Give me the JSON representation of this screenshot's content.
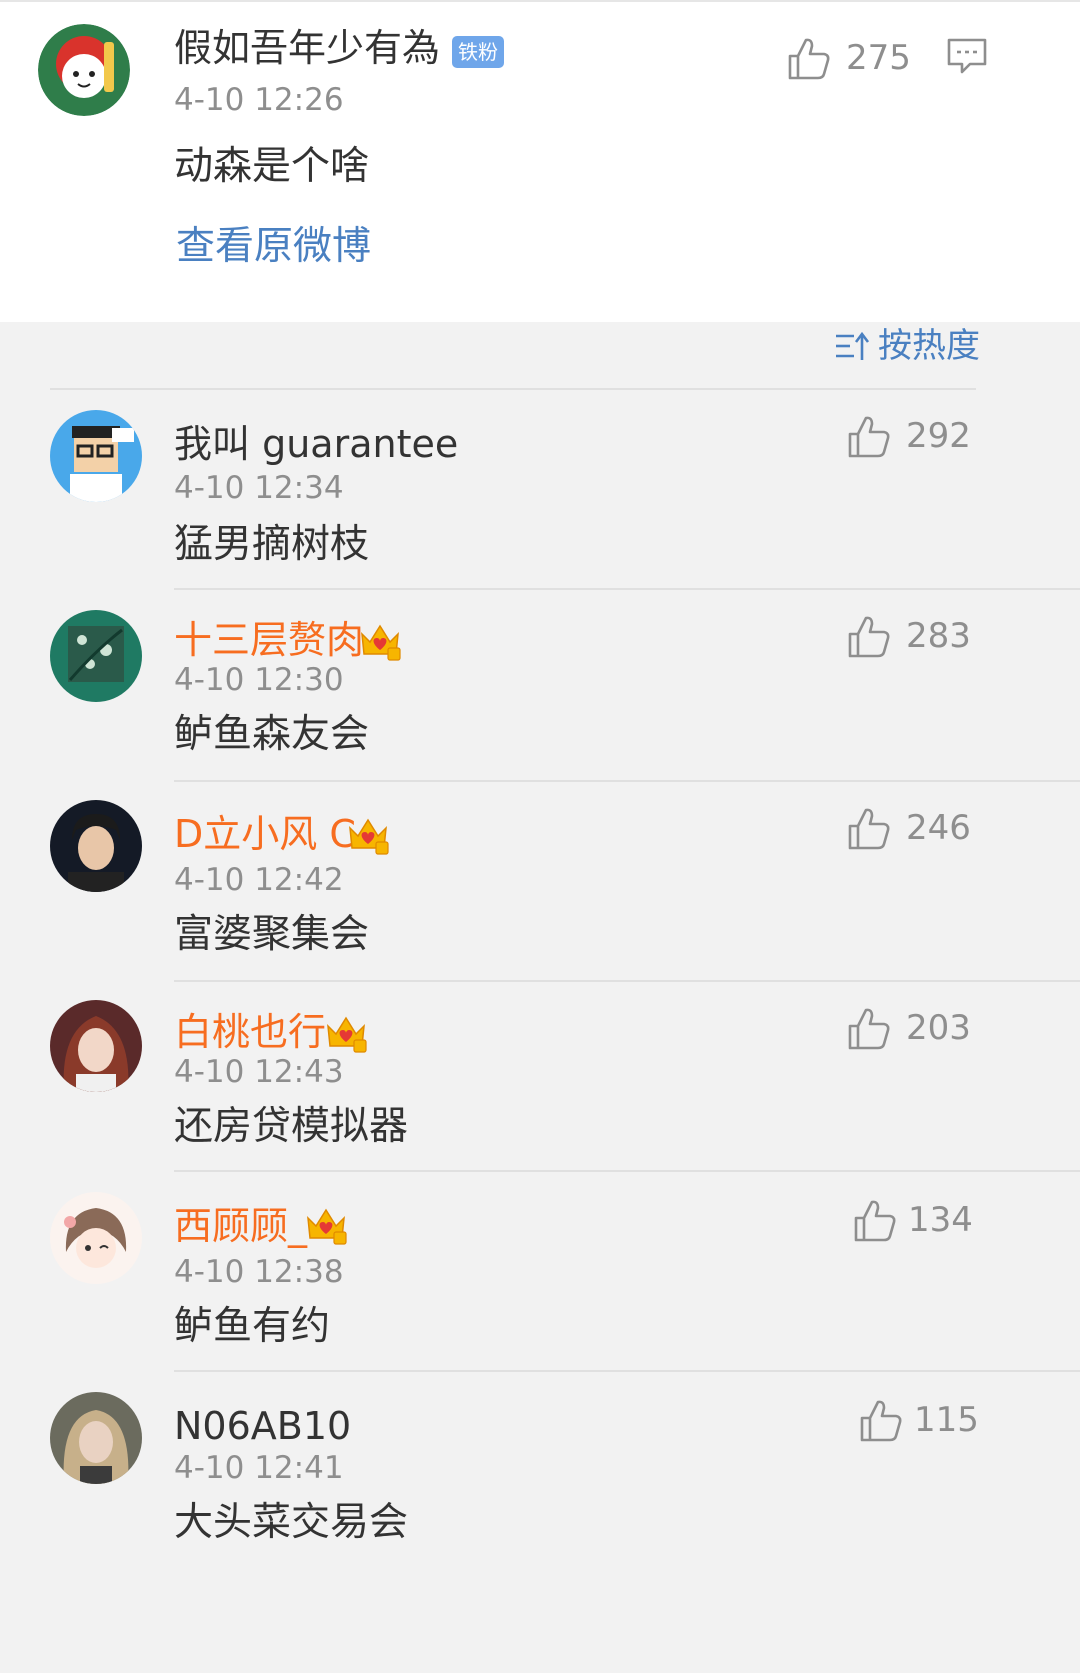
{
  "original_post": {
    "author": "假如吾年少有為",
    "badge": "铁粉",
    "time": "4-10 12:26",
    "text": "动森是个啥",
    "likes": "275",
    "view_original": "查看原微博"
  },
  "sort": {
    "label": "按热度"
  },
  "comments": [
    {
      "name": "我叫 guarantee",
      "time": "4-10 12:34",
      "text": "猛男摘树枝",
      "likes": "292"
    },
    {
      "name": "十三层赘肉",
      "time": "4-10 12:30",
      "text": "鲈鱼森友会",
      "likes": "283"
    },
    {
      "name": "D立小风 C",
      "time": "4-10 12:42",
      "text": "富婆聚集会",
      "likes": "246"
    },
    {
      "name": "白桃也行",
      "time": "4-10 12:43",
      "text": "还房贷模拟器",
      "likes": "203"
    },
    {
      "name": "西顾顾_",
      "time": "4-10 12:38",
      "text": "鲈鱼有约",
      "likes": "134"
    },
    {
      "name": "N06AB10",
      "time": "4-10 12:41",
      "text": "大头菜交易会",
      "likes": "115"
    }
  ],
  "colors": {
    "vip_name": "#f76d20",
    "link": "#4a80c1",
    "badge": "#6fa6ea",
    "meta": "#8e8e8e"
  },
  "icons": {
    "like": "thumbs-up-icon",
    "comment": "comment-icon",
    "sort": "sort-icon",
    "vip": "crown-icon"
  }
}
